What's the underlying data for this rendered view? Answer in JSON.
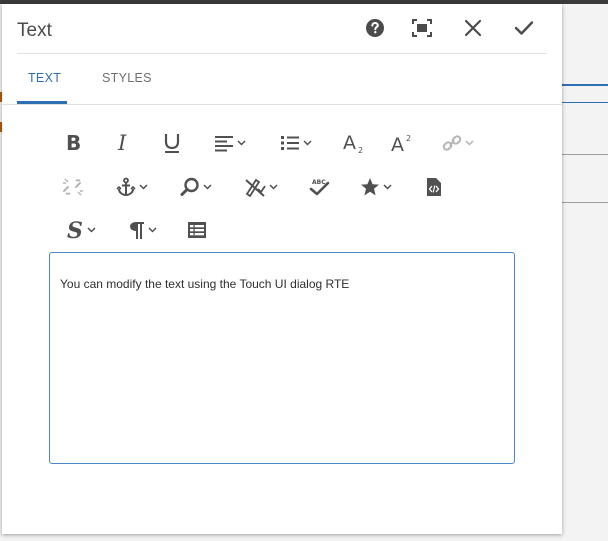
{
  "dialog": {
    "title": "Text",
    "header_buttons": {
      "help": "help-icon",
      "fullscreen": "fullscreen-icon",
      "close": "close-icon",
      "done": "checkmark-icon"
    }
  },
  "tabs": [
    {
      "label": "TEXT",
      "active": true
    },
    {
      "label": "STYLES",
      "active": false
    }
  ],
  "toolbar": {
    "row1": [
      "bold-icon",
      "italic-icon",
      "underline-icon",
      "align-left-icon",
      "list-icon",
      "subscript-icon",
      "superscript-icon",
      "link-icon"
    ],
    "row2": [
      "unlink-icon",
      "anchor-icon",
      "find-replace-icon",
      "spellcheck-off-icon",
      "spellcheck-icon",
      "special-characters-icon",
      "source-edit-icon"
    ],
    "row3": [
      "styles-icon",
      "paragraph-format-icon",
      "table-icon"
    ]
  },
  "editor": {
    "content": "You can modify the text using the Touch UI dialog RTE"
  },
  "colors": {
    "accent": "#2c6fb4",
    "icon": "#505050",
    "disabled_icon": "#b5b5b5"
  }
}
